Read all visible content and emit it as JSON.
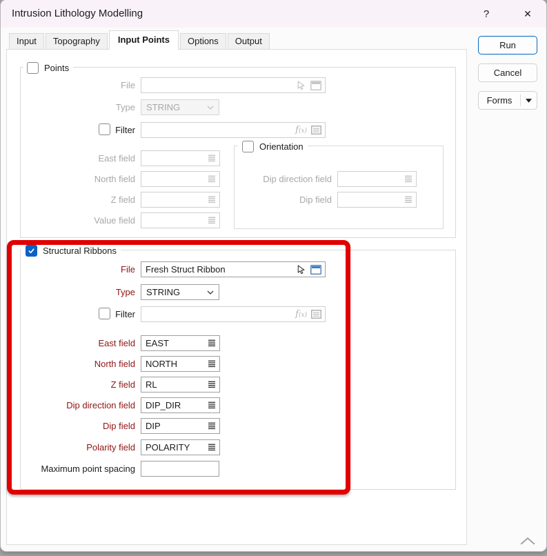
{
  "window": {
    "title": "Intrusion Lithology Modelling",
    "help": "?",
    "close": "✕"
  },
  "tabs": {
    "input": "Input",
    "topography": "Topography",
    "input_points": "Input Points",
    "options": "Options",
    "output": "Output"
  },
  "buttons": {
    "run": "Run",
    "cancel": "Cancel",
    "forms": "Forms"
  },
  "points": {
    "title": "Points",
    "checked": false,
    "file_label": "File",
    "file_value": "",
    "type_label": "Type",
    "type_value": "STRING",
    "filter_label": "Filter",
    "filter_value": "",
    "east_label": "East field",
    "east_value": "",
    "north_label": "North field",
    "north_value": "",
    "z_label": "Z field",
    "z_value": "",
    "value_label": "Value field",
    "value_value": "",
    "orientation": {
      "title": "Orientation",
      "checked": false,
      "dip_direction_label": "Dip direction field",
      "dip_direction_value": "",
      "dip_label": "Dip field",
      "dip_value": ""
    }
  },
  "ribbons": {
    "title": "Structural Ribbons",
    "checked": true,
    "file_label": "File",
    "file_value": "Fresh Struct Ribbon",
    "type_label": "Type",
    "type_value": "STRING",
    "filter_label": "Filter",
    "filter_value": "",
    "east_label": "East field",
    "east_value": "EAST",
    "north_label": "North field",
    "north_value": "NORTH",
    "z_label": "Z field",
    "z_value": "RL",
    "dip_direction_label": "Dip direction field",
    "dip_direction_value": "DIP_DIR",
    "dip_label": "Dip field",
    "dip_value": "DIP",
    "polarity_label": "Polarity field",
    "polarity_value": "POLARITY",
    "max_spacing_label": "Maximum point spacing",
    "max_spacing_value": ""
  },
  "colors": {
    "accent_blue": "#0b62c4",
    "run_border_blue": "#0067c0",
    "annotation_red": "#e10000",
    "enabled_label_maroon": "#8e1414",
    "titlebar_tint": "#f9f2f8"
  }
}
